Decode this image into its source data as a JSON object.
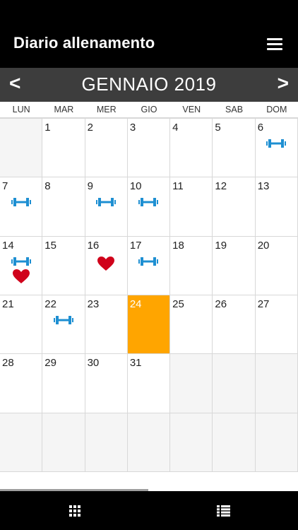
{
  "header": {
    "title": "Diario allenamento",
    "menu_icon": "hamburger-menu-icon"
  },
  "month_nav": {
    "prev_label": "<",
    "next_label": ">",
    "month_label": "GENNAIO 2019"
  },
  "weekdays": [
    "LUN",
    "MAR",
    "MER",
    "GIO",
    "VEN",
    "SAB",
    "DOM"
  ],
  "calendar": {
    "first_weekday_offset": 1,
    "days": [
      {
        "day": "1",
        "icons": []
      },
      {
        "day": "2",
        "icons": []
      },
      {
        "day": "3",
        "icons": []
      },
      {
        "day": "4",
        "icons": []
      },
      {
        "day": "5",
        "icons": []
      },
      {
        "day": "6",
        "icons": [
          "dumbbell"
        ]
      },
      {
        "day": "7",
        "icons": [
          "dumbbell"
        ]
      },
      {
        "day": "8",
        "icons": []
      },
      {
        "day": "9",
        "icons": [
          "dumbbell"
        ]
      },
      {
        "day": "10",
        "icons": [
          "dumbbell"
        ]
      },
      {
        "day": "11",
        "icons": []
      },
      {
        "day": "12",
        "icons": []
      },
      {
        "day": "13",
        "icons": []
      },
      {
        "day": "14",
        "icons": [
          "dumbbell",
          "heart"
        ]
      },
      {
        "day": "15",
        "icons": []
      },
      {
        "day": "16",
        "icons": [
          "heart"
        ]
      },
      {
        "day": "17",
        "icons": [
          "dumbbell"
        ]
      },
      {
        "day": "18",
        "icons": []
      },
      {
        "day": "19",
        "icons": []
      },
      {
        "day": "20",
        "icons": []
      },
      {
        "day": "21",
        "icons": []
      },
      {
        "day": "22",
        "icons": [
          "dumbbell"
        ]
      },
      {
        "day": "23",
        "icons": []
      },
      {
        "day": "24",
        "icons": [],
        "today": true
      },
      {
        "day": "25",
        "icons": []
      },
      {
        "day": "26",
        "icons": []
      },
      {
        "day": "27",
        "icons": []
      },
      {
        "day": "28",
        "icons": []
      },
      {
        "day": "29",
        "icons": []
      },
      {
        "day": "30",
        "icons": []
      },
      {
        "day": "31",
        "icons": []
      }
    ],
    "total_cells": 42
  },
  "colors": {
    "dumbbell": "#1e8fd2",
    "heart": "#d0021b",
    "today": "#ffa500",
    "empty_cell": "#f5f5f5"
  },
  "bottom_nav": {
    "left_icon": "grid-view-icon",
    "right_icon": "list-view-icon"
  }
}
